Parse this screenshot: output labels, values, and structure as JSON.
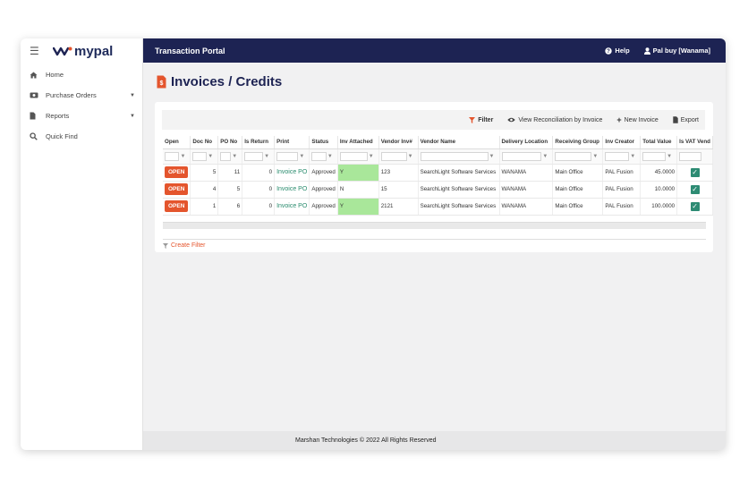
{
  "app": {
    "name": "mypal",
    "portal_title": "Transaction Portal"
  },
  "topbar": {
    "help": "Help",
    "user": "Pal buy [Wanama]"
  },
  "sidebar": {
    "items": [
      {
        "label": "Home",
        "icon": "home-icon"
      },
      {
        "label": "Purchase Orders",
        "icon": "cash-icon",
        "expandable": true
      },
      {
        "label": "Reports",
        "icon": "document-icon",
        "expandable": true
      },
      {
        "label": "Quick Find",
        "icon": "search-icon"
      }
    ]
  },
  "page": {
    "title": "Invoices / Credits"
  },
  "toolbar": {
    "filter": "Filter",
    "view_reconciliation": "View Reconciliation by Invoice",
    "new_invoice": "New Invoice",
    "export": "Export"
  },
  "grid": {
    "columns": [
      "Open",
      "Doc No",
      "PO No",
      "Is Return",
      "Print",
      "Status",
      "Inv Attached",
      "Vendor Inv#",
      "Vendor Name",
      "Delivery Location",
      "Receiving Group",
      "Inv Creator",
      "Total Value",
      "Is VAT Vend"
    ],
    "rows": [
      {
        "open": "OPEN",
        "doc_no": "5",
        "po_no": "11",
        "is_return": "0",
        "print": "Invoice PO",
        "status": "Approved",
        "inv_attached": "Y",
        "vendor_inv": "123",
        "vendor_name": "SearchLight Software Services",
        "delivery_location": "WANAMA",
        "receiving_group": "Main Office",
        "inv_creator": "PAL Fusion",
        "total_value": "45.0000",
        "is_vat_vendor": true
      },
      {
        "open": "OPEN",
        "doc_no": "4",
        "po_no": "5",
        "is_return": "0",
        "print": "Invoice PO",
        "status": "Approved",
        "inv_attached": "N",
        "vendor_inv": "15",
        "vendor_name": "SearchLight Software Services",
        "delivery_location": "WANAMA",
        "receiving_group": "Main Office",
        "inv_creator": "PAL Fusion",
        "total_value": "10.0000",
        "is_vat_vendor": true
      },
      {
        "open": "OPEN",
        "doc_no": "1",
        "po_no": "6",
        "is_return": "0",
        "print": "Invoice PO",
        "status": "Approved",
        "inv_attached": "Y",
        "vendor_inv": "2121",
        "vendor_name": "SearchLight Software Services",
        "delivery_location": "WANAMA",
        "receiving_group": "Main Office",
        "inv_creator": "PAL Fusion",
        "total_value": "100.0000",
        "is_vat_vendor": true
      }
    ],
    "create_filter": "Create Filter"
  },
  "footer": {
    "text": "Marshan Technologies © 2022 All Rights Reserved"
  },
  "colors": {
    "navy": "#1d2353",
    "accent": "#e4552d",
    "green": "#2d8b73",
    "highlight": "#a9e79a"
  }
}
